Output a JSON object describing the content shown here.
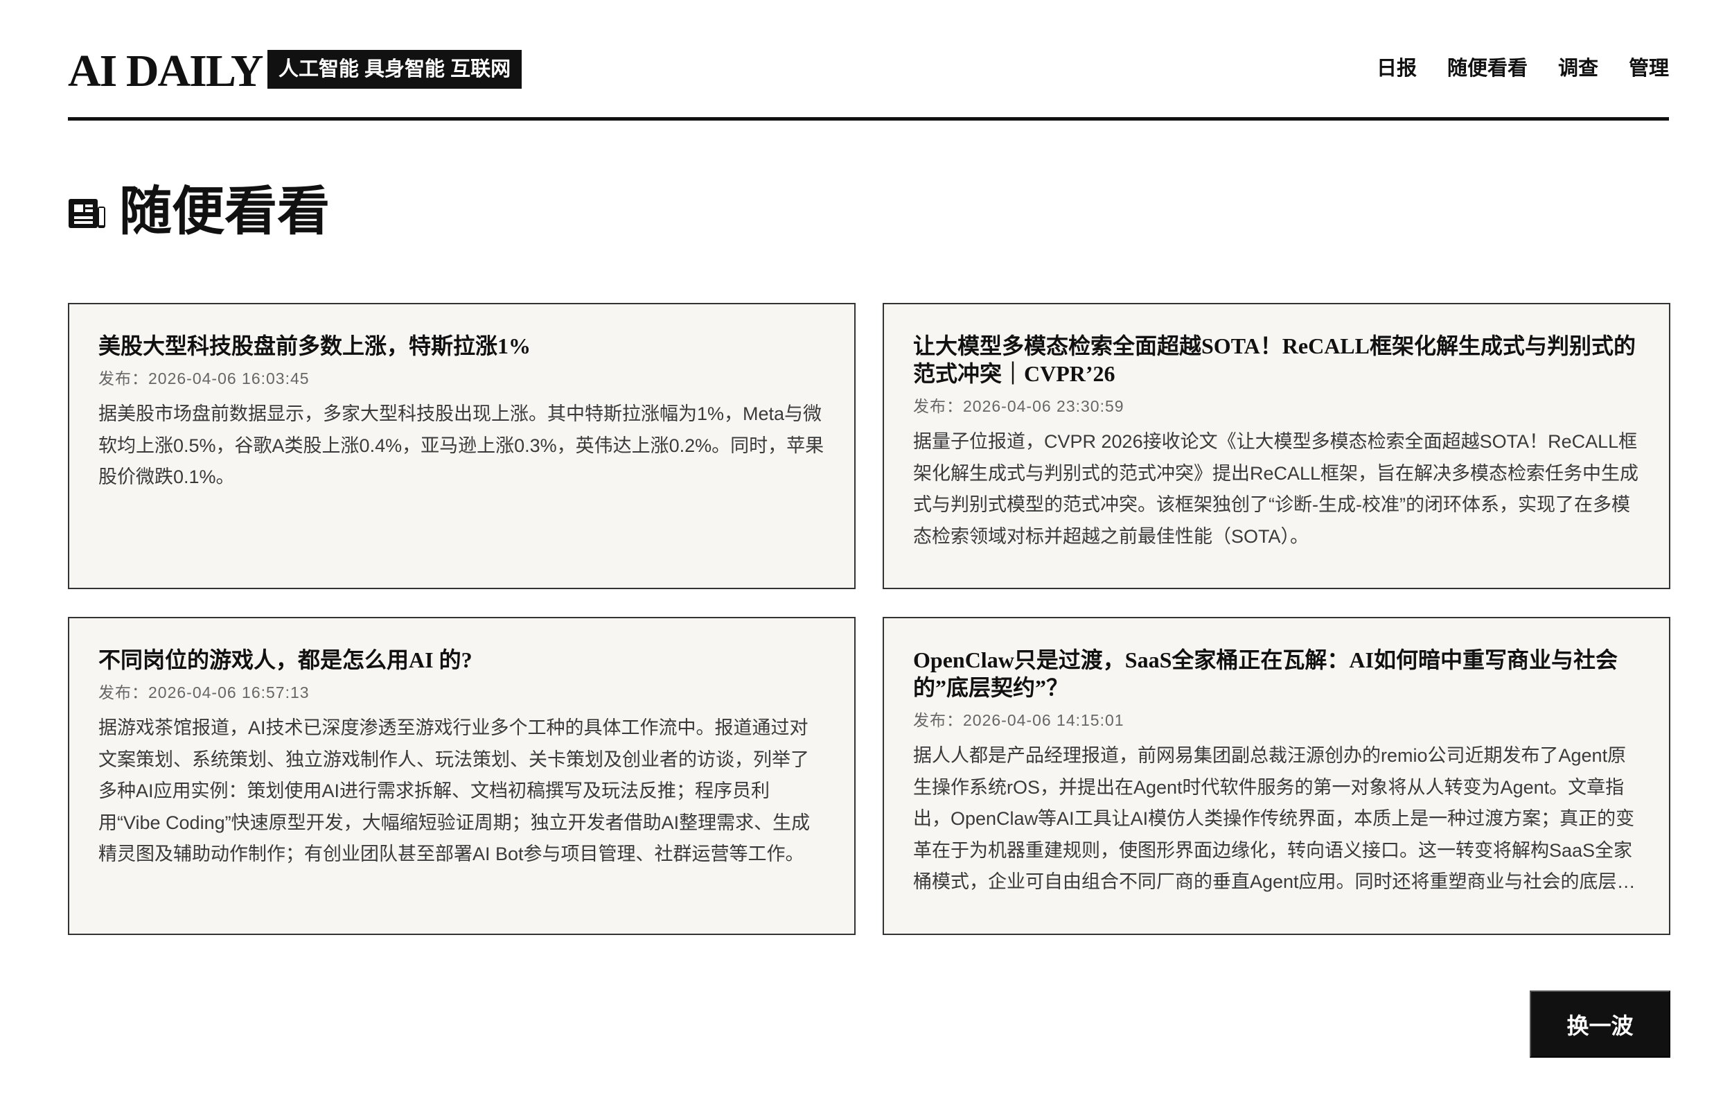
{
  "header": {
    "logo": "AI DAILY",
    "tagline": "人工智能 具身智能 互联网",
    "nav": [
      {
        "label": "日报"
      },
      {
        "label": "随便看看"
      },
      {
        "label": "调查"
      },
      {
        "label": "管理"
      }
    ]
  },
  "page": {
    "title": "随便看看",
    "title_icon": "newspaper-icon"
  },
  "cards": [
    {
      "title": "美股大型科技股盘前多数上涨，特斯拉涨1%",
      "date": "发布：2026-04-06 16:03:45",
      "summary": "据美股市场盘前数据显示，多家大型科技股出现上涨。其中特斯拉涨幅为1%，Meta与微软均上涨0.5%，谷歌A类股上涨0.4%，亚马逊上涨0.3%，英伟达上涨0.2%。同时，苹果股价微跌0.1%。"
    },
    {
      "title": "让大模型多模态检索全面超越SOTA！ReCALL框架化解生成式与判别式的范式冲突｜CVPR’26",
      "date": "发布：2026-04-06 23:30:59",
      "summary": "据量子位报道，CVPR 2026接收论文《让大模型多模态检索全面超越SOTA！ReCALL框架化解生成式与判别式的范式冲突》提出ReCALL框架，旨在解决多模态检索任务中生成式与判别式模型的范式冲突。该框架独创了“诊断-生成-校准”的闭环体系，实现了在多模态检索领域对标并超越之前最佳性能（SOTA）。"
    },
    {
      "title": "不同岗位的游戏人，都是怎么用AI 的?",
      "date": "发布：2026-04-06 16:57:13",
      "summary": "据游戏茶馆报道，AI技术已深度渗透至游戏行业多个工种的具体工作流中。报道通过对文案策划、系统策划、独立游戏制作人、玩法策划、关卡策划及创业者的访谈，列举了多种AI应用实例：策划使用AI进行需求拆解、文档初稿撰写及玩法反推；程序员利用“Vibe Coding”快速原型开发，大幅缩短验证周期；独立开发者借助AI整理需求、生成精灵图及辅助动作制作；有创业团队甚至部署AI Bot参与项目管理、社群运营等工作。"
    },
    {
      "title": "OpenClaw只是过渡，SaaS全家桶正在瓦解：AI如何暗中重写商业与社会的”底层契约”？",
      "date": "发布：2026-04-06 14:15:01",
      "summary": "据人人都是产品经理报道，前网易集团副总裁汪源创办的remio公司近期发布了Agent原生操作系统rOS，并提出在Agent时代软件服务的第一对象将从人转变为Agent。文章指出，OpenClaw等AI工具让AI模仿人类操作传统界面，本质上是一种过渡方案；真正的变革在于为机器重建规则，使图形界面边缘化，转向语义接口。这一转变将解构SaaS全家桶模式，企业可自由组合不同厂商的垂直Agent应用。同时还将重塑商业与社会的底层契约。"
    }
  ],
  "refresh_label": "换一波"
}
